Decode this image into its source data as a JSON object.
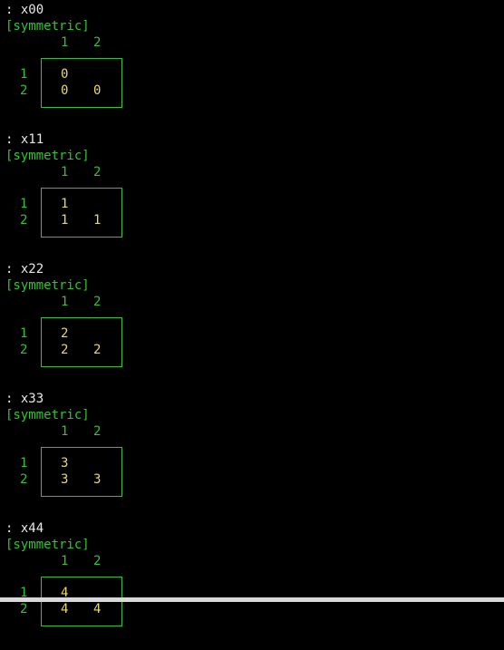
{
  "colors": {
    "background": "#000000",
    "command": "#e8e8e8",
    "label": "#33c233",
    "value": "#e8d870"
  },
  "matrices": [
    {
      "command": ": x00",
      "note": "[symmetric]",
      "col_headers": [
        "1",
        "2"
      ],
      "row_headers": [
        "1",
        "2"
      ],
      "rows": [
        [
          "0"
        ],
        [
          "0",
          "0"
        ]
      ]
    },
    {
      "command": ": x11",
      "note": "[symmetric]",
      "col_headers": [
        "1",
        "2"
      ],
      "row_headers": [
        "1",
        "2"
      ],
      "rows": [
        [
          "1"
        ],
        [
          "1",
          "1"
        ]
      ]
    },
    {
      "command": ": x22",
      "note": "[symmetric]",
      "col_headers": [
        "1",
        "2"
      ],
      "row_headers": [
        "1",
        "2"
      ],
      "rows": [
        [
          "2"
        ],
        [
          "2",
          "2"
        ]
      ]
    },
    {
      "command": ": x33",
      "note": "[symmetric]",
      "col_headers": [
        "1",
        "2"
      ],
      "row_headers": [
        "1",
        "2"
      ],
      "rows": [
        [
          "3"
        ],
        [
          "3",
          "3"
        ]
      ]
    },
    {
      "command": ": x44",
      "note": "[symmetric]",
      "col_headers": [
        "1",
        "2"
      ],
      "row_headers": [
        "1",
        "2"
      ],
      "rows": [
        [
          "4"
        ],
        [
          "4",
          "4"
        ]
      ]
    }
  ]
}
